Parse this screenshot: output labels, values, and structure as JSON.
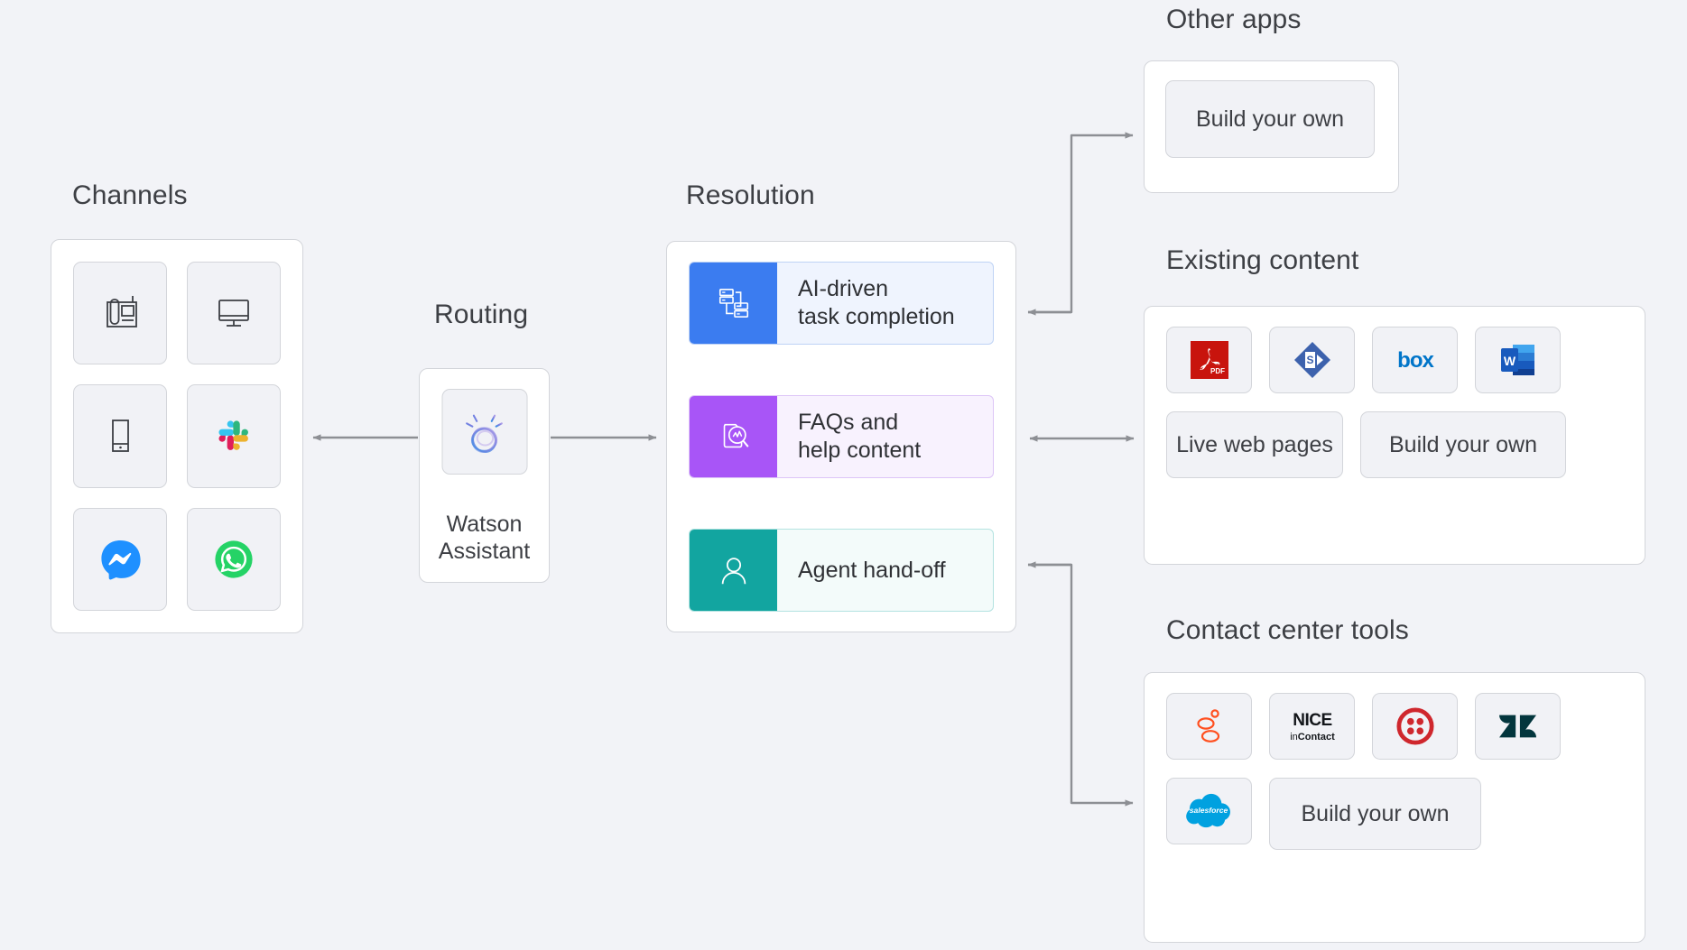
{
  "headings": {
    "channels": "Channels",
    "routing": "Routing",
    "resolution": "Resolution",
    "other_apps": "Other apps",
    "existing_content": "Existing content",
    "contact_center": "Contact center tools"
  },
  "colors": {
    "background": "#f2f3f7",
    "panel": "#ffffff",
    "tile": "#f1f2f6",
    "border": "#d3d5da",
    "text": "#3d3f44",
    "connector": "#8d8f94",
    "row_blue": "#3b7cf0",
    "row_purple": "#a855f7",
    "row_teal": "#12a5a0"
  },
  "channels": {
    "items": [
      {
        "icon": "desk-phone-icon",
        "label": "Desk phone"
      },
      {
        "icon": "desktop-monitor-icon",
        "label": "Desktop"
      },
      {
        "icon": "mobile-phone-icon",
        "label": "Mobile"
      },
      {
        "icon": "slack-icon",
        "label": "Slack"
      },
      {
        "icon": "facebook-messenger-icon",
        "label": "Facebook Messenger"
      },
      {
        "icon": "whatsapp-icon",
        "label": "WhatsApp"
      }
    ]
  },
  "routing": {
    "product_icon": "watson-assistant-icon",
    "product_name": "Watson\nAssistant",
    "product_name_line1": "Watson",
    "product_name_line2": "Assistant"
  },
  "resolution": {
    "rows": [
      {
        "icon": "task-flow-icon",
        "line1": "AI-driven",
        "line2": "task completion",
        "accent": "#3b7cf0",
        "tint": "#eff4fe",
        "border": "#bfd3f5"
      },
      {
        "icon": "document-search-icon",
        "line1": "FAQs and",
        "line2": "help content",
        "accent": "#a855f7",
        "tint": "#f8f2fe",
        "border": "#ddc5f7"
      },
      {
        "icon": "user-agent-icon",
        "line1": "Agent hand-off",
        "line2": "",
        "accent": "#12a5a0",
        "tint": "#f0fbfa",
        "border": "#b4e3e1"
      }
    ]
  },
  "other_apps": {
    "build_your_own_label": "Build your own"
  },
  "existing_content": {
    "logos": [
      {
        "icon": "adobe-pdf-icon",
        "label": "Adobe PDF"
      },
      {
        "icon": "sharepoint-icon",
        "label": "Microsoft SharePoint"
      },
      {
        "icon": "box-icon",
        "label": "Box"
      },
      {
        "icon": "microsoft-word-icon",
        "label": "Microsoft Word"
      }
    ],
    "tiles": [
      {
        "label": "Live web pages"
      },
      {
        "label": "Build your own"
      }
    ]
  },
  "contact_center": {
    "logos": [
      {
        "icon": "genesys-icon",
        "label": "Genesys"
      },
      {
        "icon": "nice-incontact-icon",
        "label": "NICE inContact",
        "text_top": "NICE",
        "text_bottom": "inContact"
      },
      {
        "icon": "twilio-icon",
        "label": "Twilio"
      },
      {
        "icon": "zendesk-icon",
        "label": "Zendesk"
      },
      {
        "icon": "salesforce-icon",
        "label": "Salesforce",
        "wordmark": "salesforce"
      }
    ],
    "tiles": [
      {
        "label": "Build your own"
      }
    ]
  },
  "connectors": [
    {
      "name": "channels-routing",
      "direction": "left"
    },
    {
      "name": "routing-resolution",
      "direction": "right"
    },
    {
      "name": "tasks-other-apps",
      "direction": "both"
    },
    {
      "name": "faqs-existing-content",
      "direction": "both"
    },
    {
      "name": "handoff-contact-center",
      "direction": "both"
    }
  ]
}
